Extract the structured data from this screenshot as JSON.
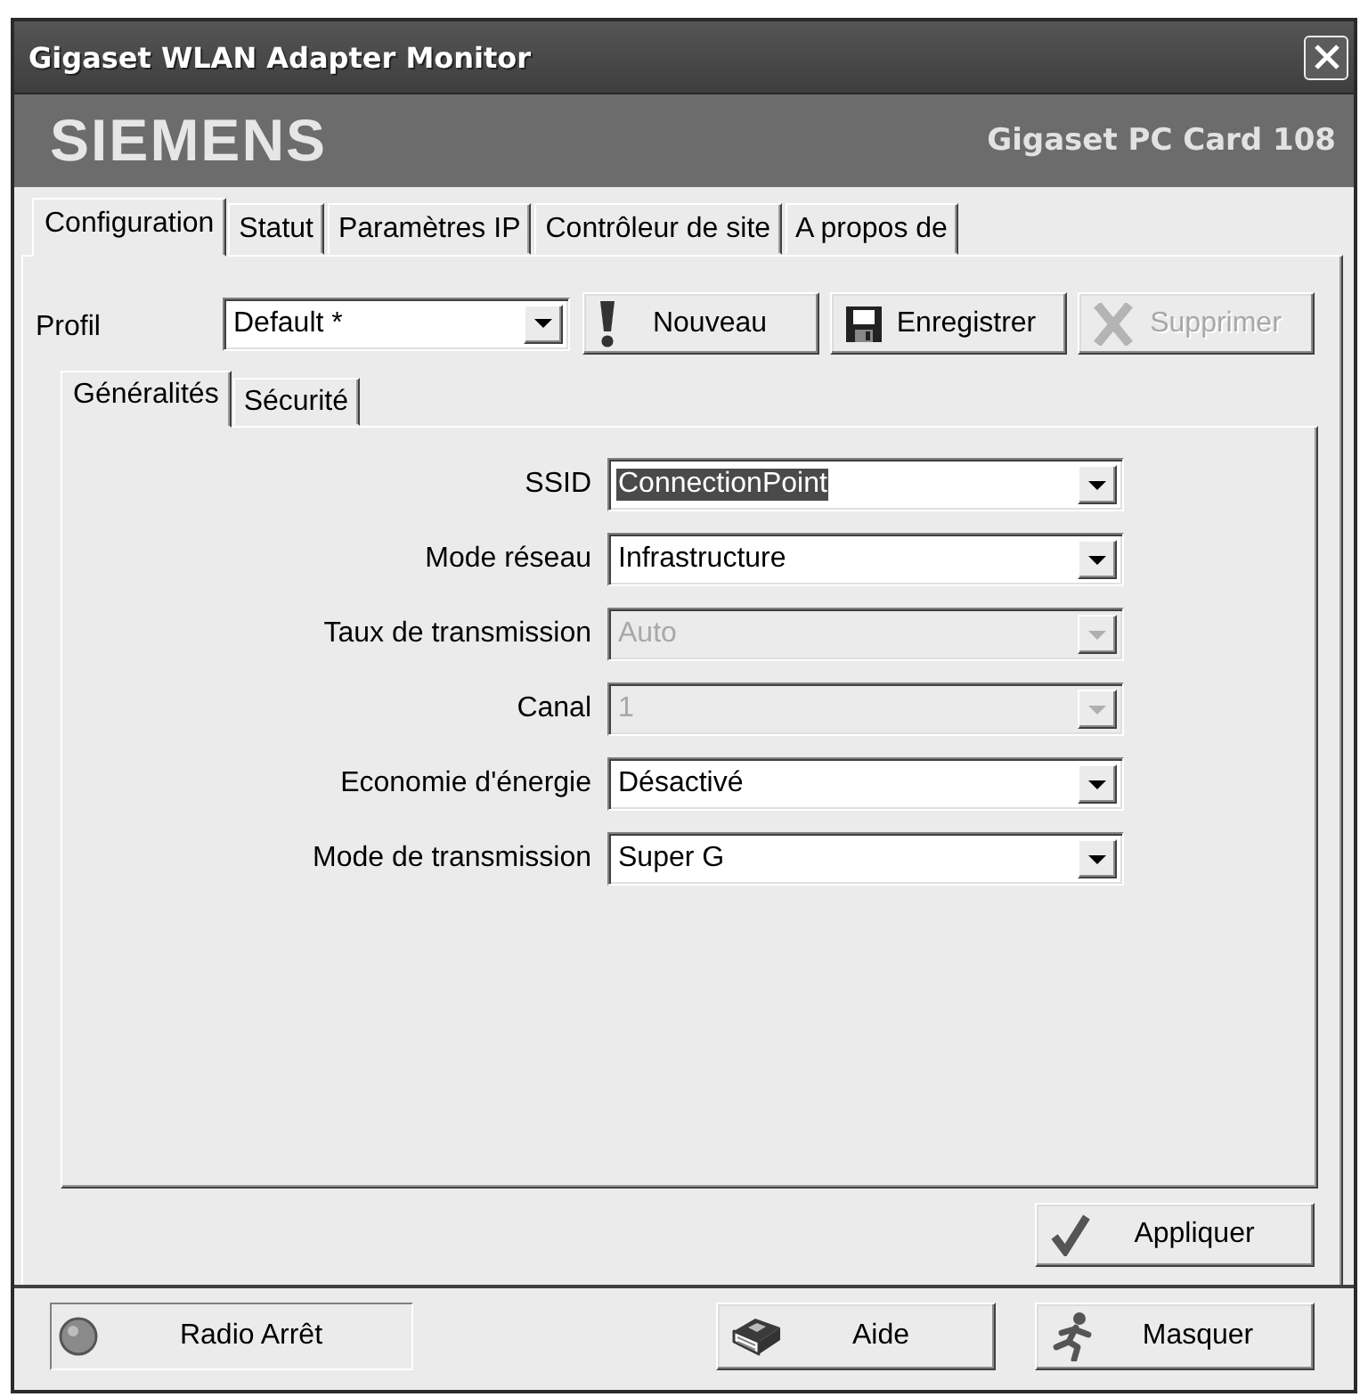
{
  "window": {
    "title": "Gigaset WLAN Adapter Monitor"
  },
  "banner": {
    "brand": "SIEMENS",
    "product": "Gigaset PC Card 108"
  },
  "tabs": [
    {
      "label": "Configuration",
      "selected": true
    },
    {
      "label": "Statut",
      "selected": false
    },
    {
      "label": "Paramètres IP",
      "selected": false
    },
    {
      "label": "Contrôleur de site",
      "selected": false
    },
    {
      "label": "A propos de",
      "selected": false
    }
  ],
  "profile": {
    "label": "Profil",
    "value": "Default *"
  },
  "profile_buttons": [
    {
      "kind": "new",
      "label": "Nouveau",
      "disabled": false
    },
    {
      "kind": "save",
      "label": "Enregistrer",
      "disabled": false
    },
    {
      "kind": "delete",
      "label": "Supprimer",
      "disabled": true
    }
  ],
  "subtabs": [
    {
      "label": "Généralités",
      "selected": true
    },
    {
      "label": "Sécurité",
      "selected": false
    }
  ],
  "fields": [
    {
      "label": "SSID",
      "value": "ConnectionPoint",
      "disabled": false,
      "highlighted": true
    },
    {
      "label": "Mode réseau",
      "value": "Infrastructure",
      "disabled": false,
      "highlighted": false
    },
    {
      "label": "Taux de transmission",
      "value": "Auto",
      "disabled": true,
      "highlighted": false
    },
    {
      "label": "Canal",
      "value": "1",
      "disabled": true,
      "highlighted": false
    },
    {
      "label": "Economie d'énergie",
      "value": "Désactivé",
      "disabled": false,
      "highlighted": false
    },
    {
      "label": "Mode de transmission",
      "value": "Super G",
      "disabled": false,
      "highlighted": false
    }
  ],
  "apply_button": {
    "label": "Appliquer"
  },
  "radio_status": {
    "label": "Radio Arrêt",
    "on": false
  },
  "footer_buttons": [
    {
      "kind": "help",
      "label": "Aide"
    },
    {
      "kind": "hide",
      "label": "Masquer"
    }
  ]
}
